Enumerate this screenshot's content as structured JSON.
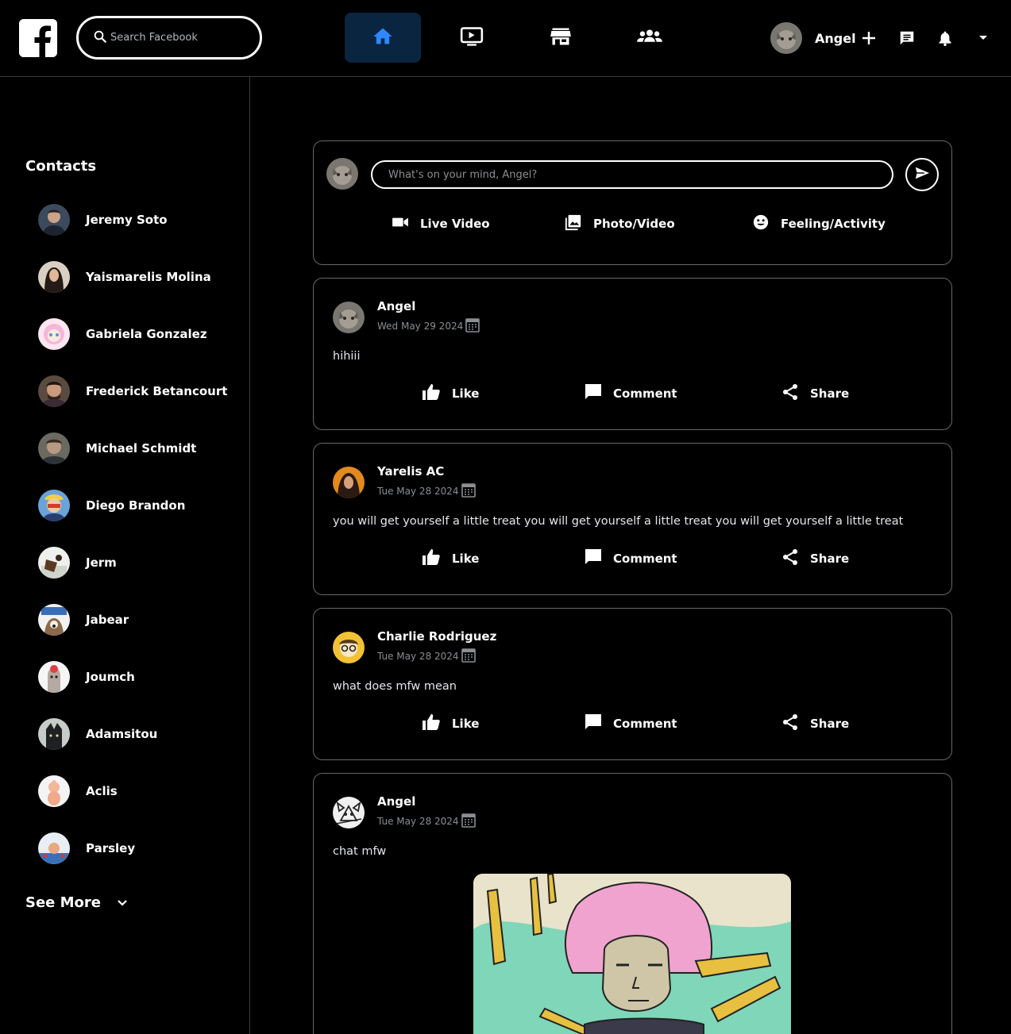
{
  "header": {
    "search_placeholder": "Search Facebook",
    "profile_name": "Angel",
    "nav": [
      "home-tab",
      "watch-tab",
      "marketplace-tab",
      "groups-tab"
    ],
    "accent": "#2d88ff"
  },
  "sidebar": {
    "title": "Contacts",
    "contacts": [
      {
        "name": "Jeremy Soto"
      },
      {
        "name": "Yaismarelis Molina"
      },
      {
        "name": "Gabriela Gonzalez"
      },
      {
        "name": "Frederick Betancourt"
      },
      {
        "name": "Michael Schmidt"
      },
      {
        "name": "Diego Brandon"
      },
      {
        "name": "Jerm"
      },
      {
        "name": "Jabear"
      },
      {
        "name": "Joumch"
      },
      {
        "name": "Adamsitou"
      },
      {
        "name": "Aclis"
      },
      {
        "name": "Parsley"
      }
    ],
    "see_more": "See More"
  },
  "composer": {
    "placeholder": "What's on your mind, Angel?",
    "actions": {
      "live": "Live Video",
      "photo": "Photo/Video",
      "feeling": "Feeling/Activity"
    }
  },
  "post_actions": {
    "like": "Like",
    "comment": "Comment",
    "share": "Share"
  },
  "posts": [
    {
      "author": "Angel",
      "date": "Wed May 29 2024",
      "text": "hihiii"
    },
    {
      "author": "Yarelis AC",
      "date": "Tue May 28 2024",
      "text": "you will get yourself a little treat you will get yourself a little treat you will get yourself a little treat"
    },
    {
      "author": "Charlie Rodriguez",
      "date": "Tue May 28 2024",
      "text": "what does mfw mean"
    },
    {
      "author": "Angel",
      "date": "Tue May 28 2024",
      "text": "chat mfw"
    }
  ]
}
